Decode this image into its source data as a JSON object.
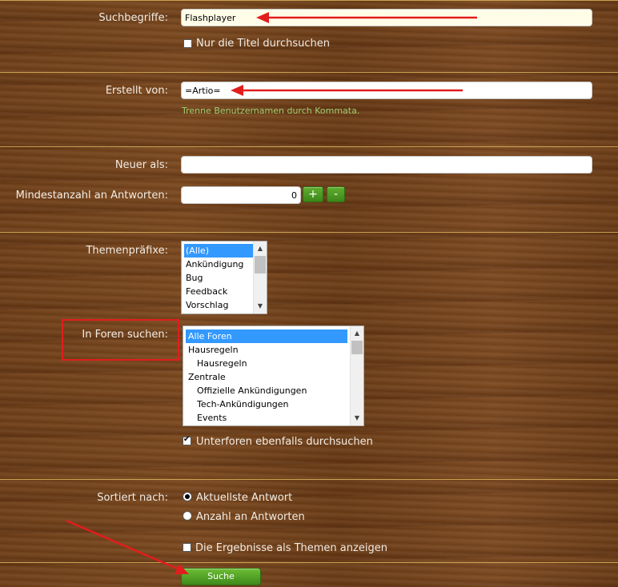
{
  "form": {
    "keywords": {
      "label": "Suchbegriffe:",
      "value": "Flashplayer"
    },
    "titles_only": {
      "label": "Nur die Titel durchsuchen",
      "checked": false
    },
    "created_by": {
      "label": "Erstellt von:",
      "value": "=Artio=",
      "hint": "Trenne Benutzernamen durch Kommata."
    },
    "newer_than": {
      "label": "Neuer als:",
      "value": ""
    },
    "min_replies": {
      "label": "Mindestanzahl an Antworten:",
      "value": "0",
      "plus_label": "+",
      "minus_label": "-"
    },
    "prefixes": {
      "label": "Themenpräfixe:",
      "options": [
        "(Alle)",
        "Ankündigung",
        "Bug",
        "Feedback",
        "Vorschlag"
      ],
      "selected": "(Alle)"
    },
    "forums": {
      "label": "In Foren suchen:",
      "options": [
        {
          "text": "Alle Foren",
          "indent": 0
        },
        {
          "text": "Hausregeln",
          "indent": 0
        },
        {
          "text": "Hausregeln",
          "indent": 1
        },
        {
          "text": "Zentrale",
          "indent": 0
        },
        {
          "text": "Offizielle Ankündigungen",
          "indent": 1
        },
        {
          "text": "Tech-Ankündigungen",
          "indent": 1
        },
        {
          "text": "Events",
          "indent": 1
        }
      ],
      "selected": "Alle Foren"
    },
    "include_subforums": {
      "label": "Unterforen ebenfalls durchsuchen",
      "checked": true
    },
    "sort_by": {
      "label": "Sortiert nach:",
      "options": [
        "Aktuellste Antwort",
        "Anzahl an Antworten"
      ],
      "selected": "Aktuellste Antwort"
    },
    "show_as_threads": {
      "label": "Die Ergebnisse als Themen anzeigen",
      "checked": false
    },
    "submit_label": "Suche"
  },
  "colors": {
    "separator": "#d9b35a",
    "hint": "#9fce6d",
    "selection": "#3399ff",
    "button_green": "#4a9a24",
    "annotation_red": "#e21d1d"
  }
}
